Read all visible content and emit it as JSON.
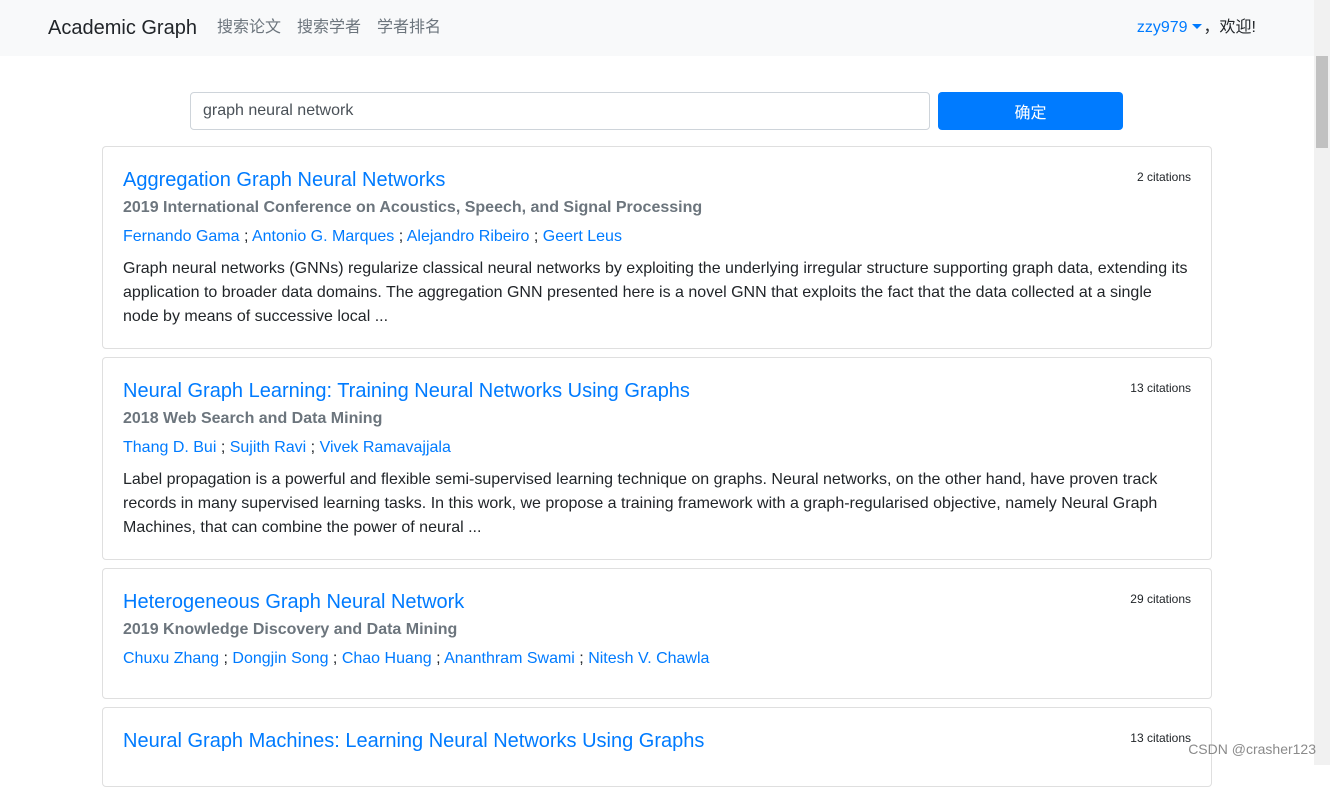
{
  "navbar": {
    "brand": "Academic Graph",
    "links": [
      "搜索论文",
      "搜索学者",
      "学者排名"
    ],
    "username": "zzy979",
    "welcome": "，欢迎!"
  },
  "search": {
    "value": "graph neural network",
    "button_label": "确定"
  },
  "results": [
    {
      "title": "Aggregation Graph Neural Networks",
      "citations": "2 citations",
      "venue": "2019 International Conference on Acoustics, Speech, and Signal Processing",
      "authors": [
        "Fernando Gama",
        "Antonio G. Marques",
        "Alejandro Ribeiro",
        "Geert Leus"
      ],
      "abstract": "Graph neural networks (GNNs) regularize classical neural networks by exploiting the underlying irregular structure supporting graph data, extending its application to broader data domains. The aggregation GNN presented here is a novel GNN that exploits the fact that the data collected at a single node by means of successive local ..."
    },
    {
      "title": "Neural Graph Learning: Training Neural Networks Using Graphs",
      "citations": "13 citations",
      "venue": "2018 Web Search and Data Mining",
      "authors": [
        "Thang D. Bui",
        "Sujith Ravi",
        "Vivek Ramavajjala"
      ],
      "abstract": "Label propagation is a powerful and flexible semi-supervised learning technique on graphs. Neural networks, on the other hand, have proven track records in many supervised learning tasks. In this work, we propose a training framework with a graph-regularised objective, namely Neural Graph Machines, that can combine the power of neural ..."
    },
    {
      "title": "Heterogeneous Graph Neural Network",
      "citations": "29 citations",
      "venue": "2019 Knowledge Discovery and Data Mining",
      "authors": [
        "Chuxu Zhang",
        "Dongjin Song",
        "Chao Huang",
        "Ananthram Swami",
        "Nitesh V. Chawla"
      ],
      "abstract": ""
    },
    {
      "title": "Neural Graph Machines: Learning Neural Networks Using Graphs",
      "citations": "13 citations",
      "venue": "",
      "authors": [],
      "abstract": ""
    }
  ],
  "watermark": "CSDN @crasher123"
}
